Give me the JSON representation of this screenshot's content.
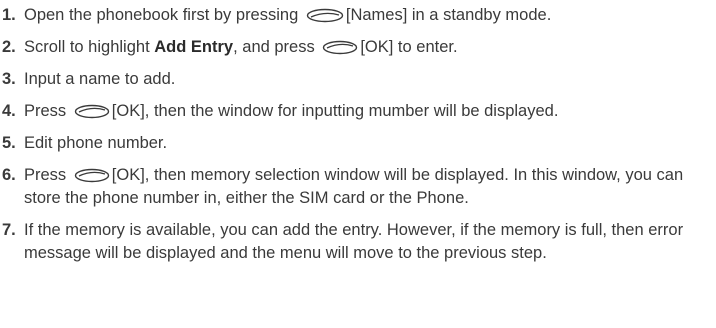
{
  "steps": [
    {
      "num": "1.",
      "before": "Open the phonebook first by pressing",
      "icon": "oval-softkey-icon",
      "after": "[Names] in a standby mode."
    },
    {
      "num": "2.",
      "before": "Scroll to highlight",
      "bold": "Add Entry",
      "middle": ", and press",
      "icon": "oval-softkey-icon",
      "after": "[OK] to enter."
    },
    {
      "num": "3.",
      "text": "Input a name to add."
    },
    {
      "num": "4.",
      "before": "Press",
      "icon": "oval-softkey-icon",
      "after": "[OK], then the window for inputting mumber will be displayed."
    },
    {
      "num": "5.",
      "text": "Edit phone number."
    },
    {
      "num": "6.",
      "before": "Press",
      "icon": "oval-softkey-icon",
      "after": "[OK], then memory selection window will be displayed. In this window, you can store the phone number in, either the SIM card or the Phone."
    },
    {
      "num": "7.",
      "text": "If the memory is available, you can add the entry. However, if the memory is full, then error message will be displayed and the menu will move to the previous step."
    }
  ]
}
